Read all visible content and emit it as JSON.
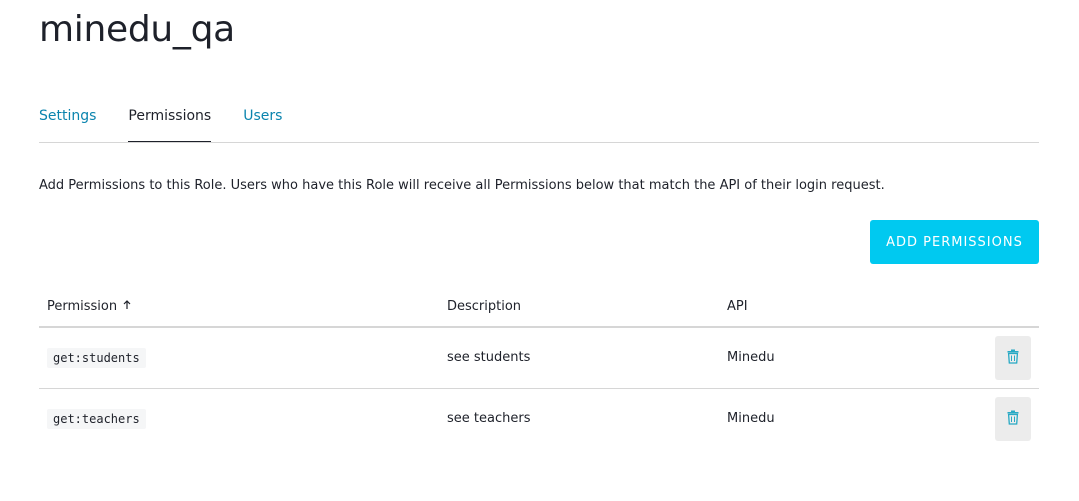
{
  "role": {
    "title": "minedu_qa"
  },
  "tabs": [
    {
      "label": "Settings",
      "active": false
    },
    {
      "label": "Permissions",
      "active": true
    },
    {
      "label": "Users",
      "active": false
    }
  ],
  "permissions_section": {
    "description": "Add Permissions to this Role. Users who have this Role will receive all Permissions below that match the API of their login request.",
    "add_button_label": "ADD PERMISSIONS",
    "table": {
      "headers": {
        "permission": "Permission",
        "description": "Description",
        "api": "API"
      },
      "sort_icon": "arrow-up-icon",
      "rows": [
        {
          "permission": "get:students",
          "description": "see students",
          "api": "Minedu",
          "action_icon": "trash-icon"
        },
        {
          "permission": "get:teachers",
          "description": "see teachers",
          "api": "Minedu",
          "action_icon": "trash-icon"
        }
      ]
    }
  },
  "colors": {
    "accent": "#00c9f0",
    "link": "#0a84ae",
    "text": "#1e212a",
    "border": "#d6d6d6",
    "delete_icon": "#27a9c4"
  }
}
